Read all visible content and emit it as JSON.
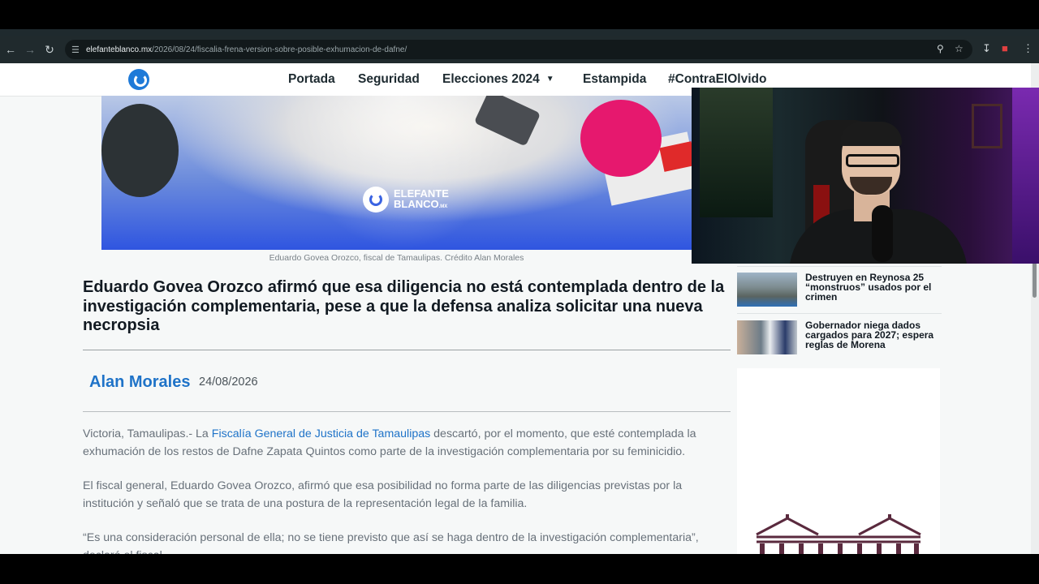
{
  "browser": {
    "url_host": "elefanteblanco.mx",
    "url_path": "/2026/08/24/fiscalia-frena-version-sobre-posible-exhumacion-de-dafne/"
  },
  "site_nav": {
    "logo": "elefante-logo-icon",
    "items": [
      "Portada",
      "Seguridad",
      "Elecciones 2024",
      "Estampida",
      "#ContraElOlvido"
    ],
    "dropdown_icon": "caret-down-icon"
  },
  "hero": {
    "watermark_line1": "ELEFANTE",
    "watermark_line2": "BLANCO",
    "watermark_suffix": ".MX",
    "caption": "Eduardo Govea Orozco, fiscal de Tamaulipas. Crédito Alan Morales"
  },
  "article": {
    "subheadline": "Eduardo Govea Orozco afirmó que esa diligencia no está contemplada dentro de la investigación complementaria, pese a que la defensa analiza solicitar una nueva necropsia",
    "author": "Alan Morales",
    "date": "24/08/2026",
    "p1_before": "Victoria, Tamaulipas.- La ",
    "p1_link": "Fiscalía General de Justicia de Tamaulipas",
    "p1_after": " descartó, por el momento, que esté contemplada la exhumación de los restos de Dafne Zapata Quintos como parte de la investigación complementaria por su feminicidio.",
    "p2": "El fiscal general, Eduardo Govea Orozco, afirmó que esa posibilidad no forma parte de las diligencias previstas por la institución y señaló que se trata de una postura de la representación legal de la familia.",
    "p3": "“Es una consideración personal de ella; no se tiene previsto que así se haga dentro de la investigación complementaria”, declaró el fiscal."
  },
  "sidebar": {
    "items": [
      {
        "title": "Destruyen en Reynosa 25 “monstruos” usados por el crimen"
      },
      {
        "title": "Gobernador niega dados cargados para 2027; espera reglas de Morena"
      }
    ]
  },
  "colors": {
    "link_blue": "#1f73c8",
    "brand_blue": "#1e7ad8",
    "heading": "#121a22"
  }
}
